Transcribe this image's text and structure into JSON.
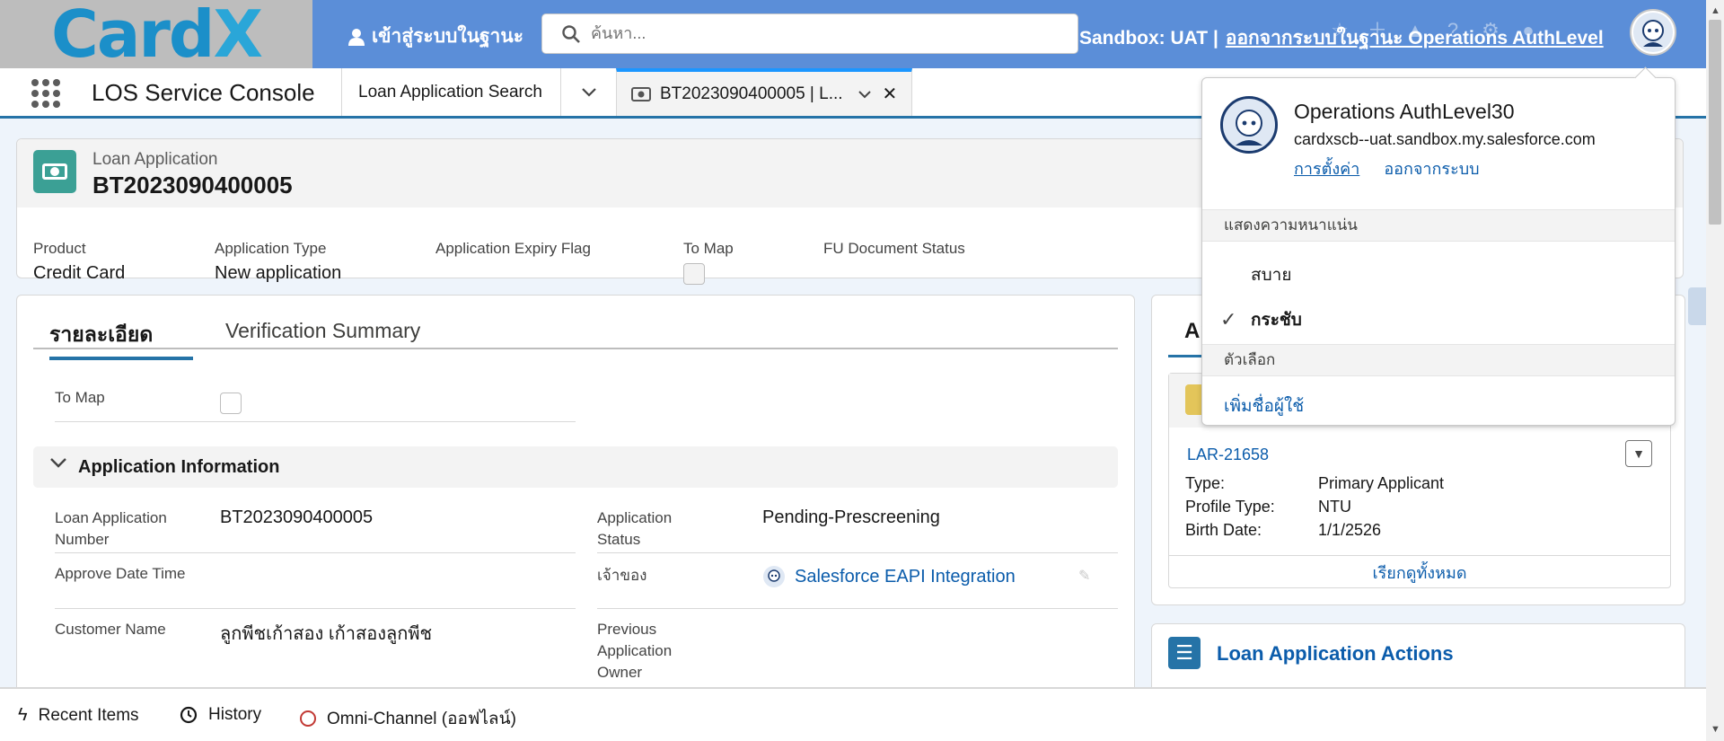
{
  "header": {
    "logo_part1": "Card",
    "logo_part2": "X",
    "login_as": "เข้าสู่ระบบในฐานะ",
    "search_placeholder": "ค้นหา...",
    "sandbox": "Sandbox: UAT |",
    "logout_as": "ออกจากระบบในฐานะ Operations AuthLevel"
  },
  "nav": {
    "app_name": "LOS Service Console",
    "tab_search": "Loan Application Search",
    "tab_record": "BT2023090400005 | L..."
  },
  "highlights": {
    "object": "Loan Application",
    "name": "BT2023090400005",
    "fields": [
      {
        "label": "Product",
        "value": "Credit Card"
      },
      {
        "label": "Application Type",
        "value": "New application"
      },
      {
        "label": "Application Expiry Flag",
        "value": ""
      },
      {
        "label": "To Map",
        "value": ""
      },
      {
        "label": "FU Document Status",
        "value": ""
      }
    ]
  },
  "detail": {
    "tabs": [
      "รายละเอียด",
      "Verification Summary"
    ],
    "to_map_label": "To Map",
    "section_title": "Application Information",
    "left_fields": [
      {
        "label": "Loan Application Number",
        "value": "BT2023090400005"
      },
      {
        "label": "Approve Date Time",
        "value": ""
      },
      {
        "label": "Customer Name",
        "value": "ลูกพีชเก้าสอง เก้าสองลูกพีช"
      }
    ],
    "right_fields": [
      {
        "label": "Application Status",
        "value": "Pending-Prescreening"
      },
      {
        "label": "เจ้าของ",
        "value": "Salesforce EAPI Integration"
      },
      {
        "label": "Previous Application Owner",
        "value": ""
      }
    ]
  },
  "applicant_card": {
    "title": "Ap",
    "record": "LAR-21658",
    "rows": [
      {
        "key": "Type:",
        "value": "Primary Applicant"
      },
      {
        "key": "Profile Type:",
        "value": "NTU"
      },
      {
        "key": "Birth Date:",
        "value": "1/1/2526"
      }
    ],
    "view_all": "เรียกดูทั้งหมด"
  },
  "actions_card": {
    "title": "Loan Application Actions"
  },
  "user_menu": {
    "name": "Operations AuthLevel30",
    "domain": "cardxscb--uat.sandbox.my.salesforce.com",
    "settings": "การตั้งค่า",
    "logout": "ออกจากระบบ",
    "density_header": "แสดงความหนาแน่น",
    "density_options": [
      "สบาย",
      "กระชับ"
    ],
    "options_header": "ตัวเลือก",
    "add_user": "เพิ่มชื่อผู้ใช้"
  },
  "footer": {
    "items": [
      "Recent Items",
      "History",
      "Omni-Channel (ออฟไลน์)"
    ]
  },
  "colors": {
    "header_blue": "#5b8ed8",
    "brand_blue": "#2573a7",
    "link": "#0b5cab",
    "object_icon": "#3ba095",
    "offline": "#c23934"
  },
  "icons": [
    "user-icon",
    "search-icon",
    "waffle-icon",
    "chevron-down-icon",
    "money-icon",
    "close-icon",
    "checkmark-icon",
    "lightning-icon",
    "clock-icon",
    "list-icon"
  ]
}
